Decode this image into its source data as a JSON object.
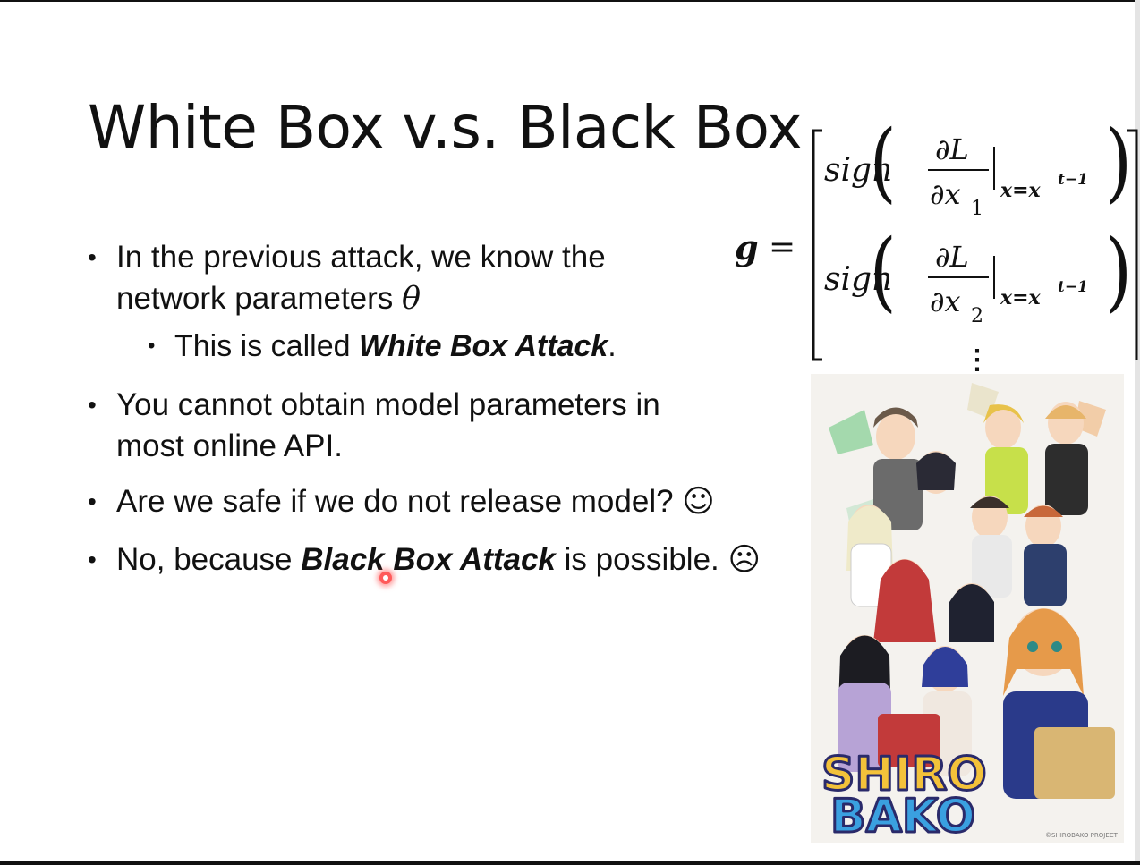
{
  "slide": {
    "title": "White Box v.s. Black Box",
    "bullets": [
      {
        "line1": "In the previous attack, we know the",
        "line2_prefix": "network parameters ",
        "line2_symbol": "θ",
        "sub": {
          "prefix": "This is called ",
          "emphasis": "White Box Attack",
          "suffix": "."
        }
      },
      {
        "line1": "You cannot obtain model parameters in",
        "line2": "most online API."
      },
      {
        "text": "Are we safe if we do not release model? ",
        "emoji": "☺"
      },
      {
        "prefix": "No, because ",
        "emphasis": "Black Box Attack",
        "suffix": " is possible. ",
        "emoji": "☹"
      }
    ],
    "formula": {
      "lhs": "g",
      "equals": "=",
      "rows": [
        {
          "fn": "sign",
          "numerator": "∂L",
          "denominator": "∂x",
          "subscript": "1",
          "cond": "x=x",
          "cond_sup": "t−1"
        },
        {
          "fn": "sign",
          "numerator": "∂L",
          "denominator": "∂x",
          "subscript": "2",
          "cond": "x=x",
          "cond_sup": "t−1"
        }
      ],
      "vdots": "⋮"
    },
    "artwork": {
      "logo_line1": "SHIRO",
      "logo_line2": "BAKO",
      "copyright": "©SHIROBAKO PROJECT",
      "colors": {
        "logo_fill_top": "#f3c23a",
        "logo_fill_bottom": "#3aa0e0",
        "logo_outline": "#2a2a6a"
      }
    }
  }
}
